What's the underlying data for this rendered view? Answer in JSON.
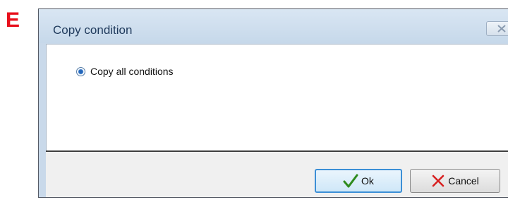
{
  "panel_letter": "E",
  "dialog": {
    "title": "Copy condition",
    "options": [
      {
        "label": "Copy all conditions",
        "selected": true
      }
    ],
    "buttons": {
      "ok_label": "Ok",
      "cancel_label": "Cancel"
    }
  },
  "colors": {
    "panel_letter": "#e8101c",
    "ok_check": "#2e8b1e",
    "cancel_x": "#d81e1e",
    "focus_border": "#3c8fd6"
  },
  "icons": {
    "close": "close-icon",
    "ok": "checkmark-icon",
    "cancel": "x-icon"
  }
}
